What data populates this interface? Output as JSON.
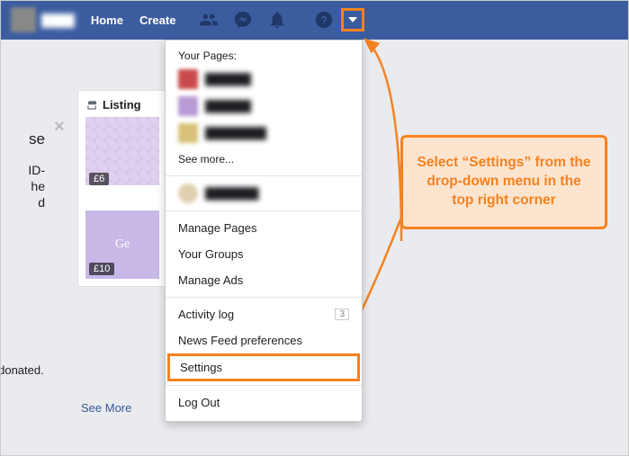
{
  "nav": {
    "home": "Home",
    "create": "Create",
    "username": "████"
  },
  "sidebar": {
    "listing_header": "Listing",
    "price1": "£6",
    "price2": "£10",
    "gem_label": "Ge",
    "close": "×"
  },
  "left_text": {
    "line1": "se",
    "line2": "ID-",
    "line3": "he",
    "line4": "d",
    "donated": "s donated.",
    "see_more": "See More"
  },
  "dropdown": {
    "your_pages": "Your Pages:",
    "page1": "██████",
    "page2": "██████",
    "page3": "████████",
    "see_more": "See more...",
    "name_row": "███████",
    "manage_pages": "Manage Pages",
    "your_groups": "Your Groups",
    "manage_ads": "Manage Ads",
    "activity_log": "Activity log",
    "activity_count": "3",
    "news_feed_prefs": "News Feed preferences",
    "settings": "Settings",
    "log_out": "Log Out"
  },
  "callout": {
    "text": "Select “Settings” from the drop-down menu in the top right corner"
  },
  "colors": {
    "accent": "#f58220",
    "bar": "#3b5da0"
  }
}
